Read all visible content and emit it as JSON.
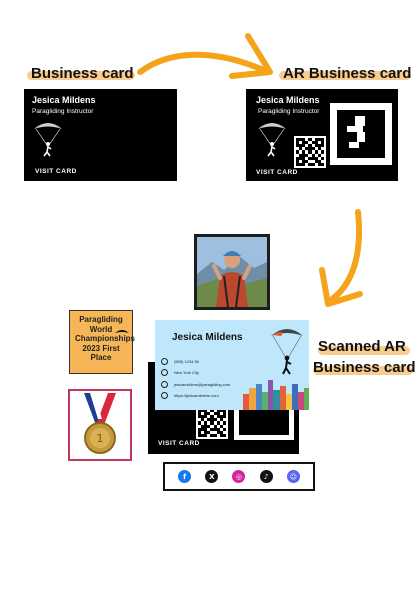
{
  "labels": {
    "business_card": "Business card",
    "ar_business_card": "AR Business card",
    "scanned_line1": "Scanned AR",
    "scanned_line2": "Business card"
  },
  "card": {
    "name": "Jesica Mildens",
    "title": "Paragliding Instructor",
    "visit": "VISIT CARD"
  },
  "scanned": {
    "name": "Jesica Mildens",
    "phone": "(555) 1234 56",
    "city": "New York City",
    "email": "jesicamildens@paragliding.com",
    "website": "https://jesicamildens.com"
  },
  "award": {
    "text": "Paragliding World Championships 2023 First Place"
  },
  "socials": [
    {
      "name": "facebook",
      "glyph": "f",
      "color": "#1877f2"
    },
    {
      "name": "x",
      "glyph": "X",
      "color": "#111111"
    },
    {
      "name": "instagram",
      "glyph": "◎",
      "color": "#d6249f"
    },
    {
      "name": "tiktok",
      "glyph": "♪",
      "color": "#111111"
    },
    {
      "name": "discord",
      "glyph": "☺",
      "color": "#5865f2"
    }
  ],
  "colors": {
    "arrow": "#f5a31a",
    "highlight": "#f7c27a",
    "card_bg": "#000000",
    "scanned_bg": "#bfe7fb",
    "award_bg": "#f6b657"
  }
}
